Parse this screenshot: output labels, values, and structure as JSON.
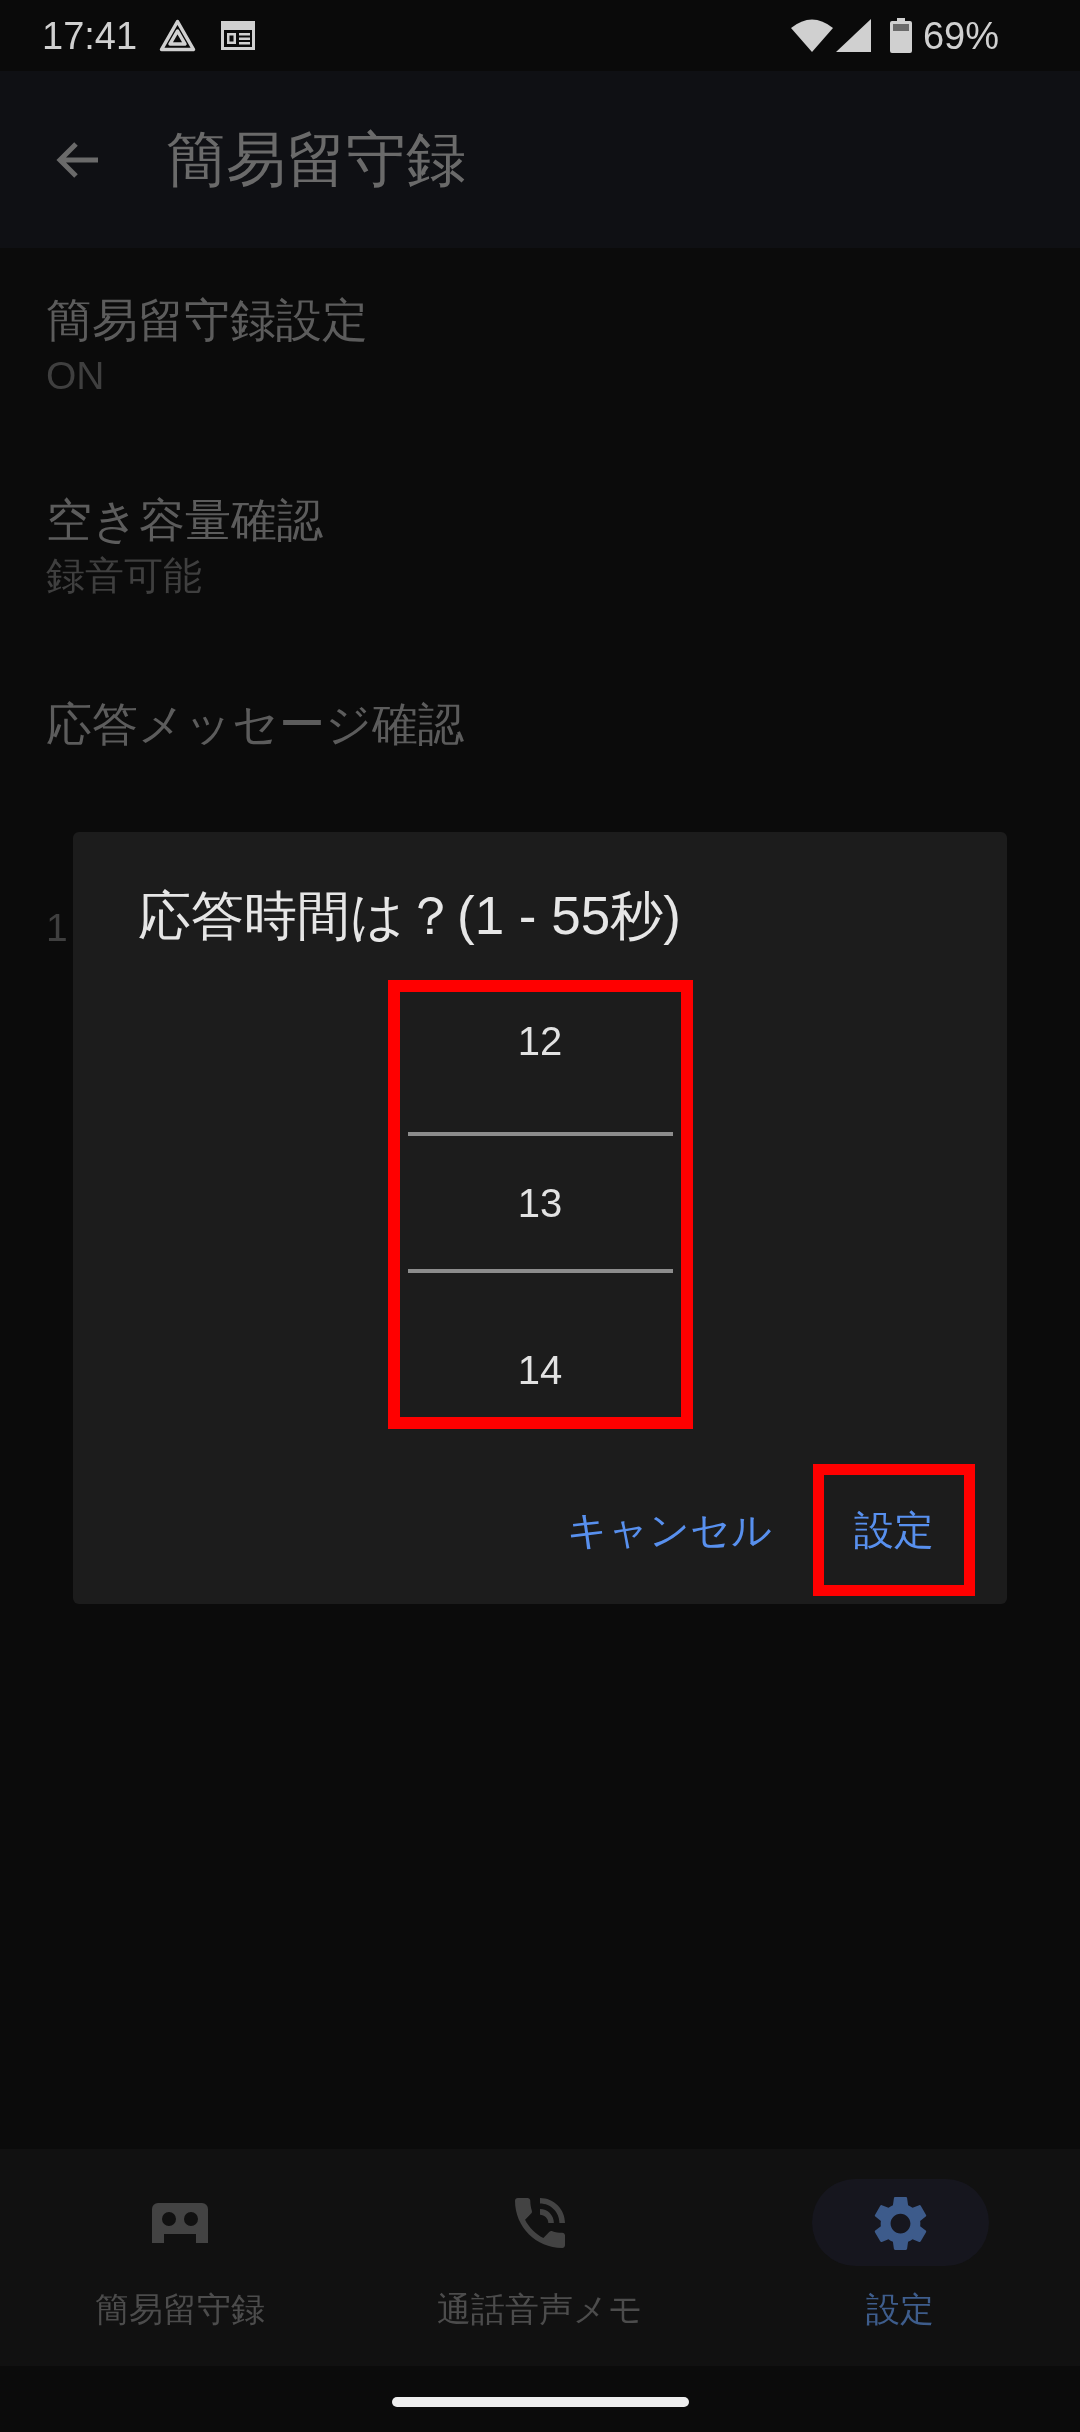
{
  "status_bar": {
    "time": "17:41",
    "battery": "69%"
  },
  "app_bar": {
    "title": "簡易留守録"
  },
  "settings": [
    {
      "title": "簡易留守録設定",
      "value": "ON"
    },
    {
      "title": "空き容量確認",
      "value": "録音可能"
    },
    {
      "title": "応答メッセージ確認"
    },
    {
      "value": "1"
    }
  ],
  "dialog": {
    "title": "応答時間は？(1 - 55秒)",
    "picker": {
      "highlighted": true,
      "values": [
        {
          "label": "12",
          "selected": false
        },
        {
          "label": "13",
          "selected": true
        },
        {
          "label": "14",
          "selected": false
        }
      ]
    },
    "buttons": [
      {
        "label": "キャンセル",
        "highlighted": false
      },
      {
        "label": "設定",
        "highlighted": true
      }
    ]
  },
  "bottom_nav": [
    {
      "label": "簡易留守録",
      "selected": false
    },
    {
      "label": "通話音声メモ",
      "selected": false
    },
    {
      "label": "設定",
      "selected": true
    }
  ]
}
